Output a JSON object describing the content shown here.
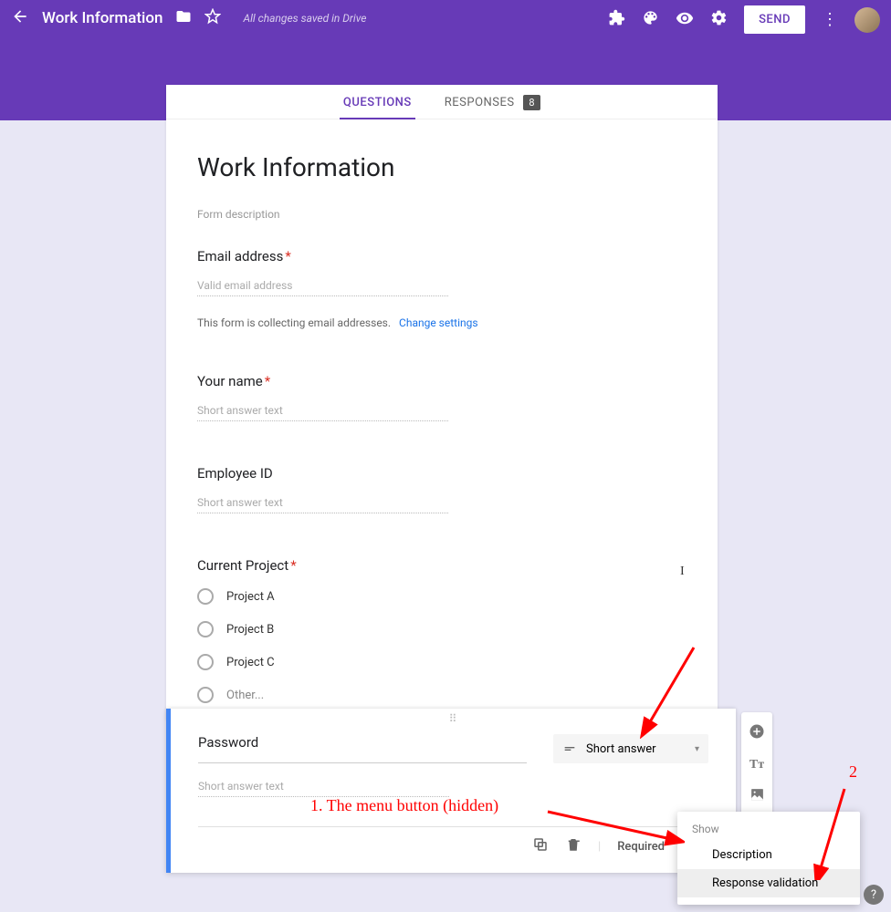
{
  "header": {
    "title": "Work Information",
    "save_status": "All changes saved in Drive",
    "send_label": "SEND"
  },
  "tabs": {
    "questions": "QUESTIONS",
    "responses": "RESPONSES",
    "response_count": "8"
  },
  "form": {
    "title": "Work Information",
    "description_placeholder": "Form description",
    "email": {
      "label": "Email address",
      "placeholder": "Valid email address",
      "note": "This form is collecting email addresses.",
      "change_link": "Change settings"
    },
    "name": {
      "label": "Your name",
      "placeholder": "Short answer text"
    },
    "employee_id": {
      "label": "Employee ID",
      "placeholder": "Short answer text"
    },
    "project": {
      "label": "Current Project",
      "options": [
        "Project A",
        "Project B",
        "Project C",
        "Other..."
      ]
    }
  },
  "active_question": {
    "title": "Password",
    "placeholder": "Short answer text",
    "type_label": "Short answer",
    "required_label": "Required"
  },
  "popup": {
    "title": "Show",
    "items": [
      "Description",
      "Response validation"
    ]
  },
  "annotations": {
    "label1": "1. The menu button (hidden)",
    "label2": "2"
  }
}
